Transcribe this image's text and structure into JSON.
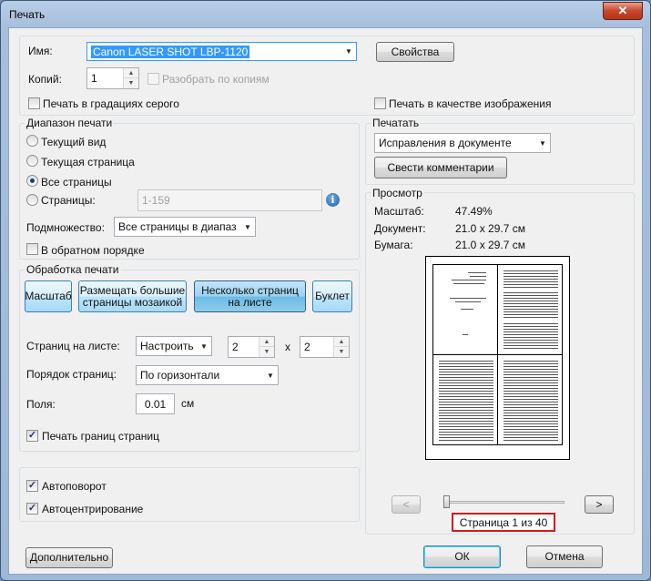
{
  "window": {
    "title": "Печать",
    "close_glyph": "✕"
  },
  "printer": {
    "name_label": "Имя:",
    "name_value": "Canon LASER SHOT LBP-1120",
    "properties_button": "Свойства",
    "copies_label": "Копий:",
    "copies_value": "1",
    "collate_label": "Разобрать по копиям",
    "grayscale_label": "Печать в градациях серого",
    "print_as_image_label": "Печать в качестве изображения"
  },
  "range": {
    "title": "Диапазон печати",
    "options": [
      "Текущий вид",
      "Текущая страница",
      "Все страницы",
      "Страницы:"
    ],
    "selected_index": 2,
    "pages_placeholder": "1-159",
    "subset_label": "Подмножество:",
    "subset_value": "Все страницы в диапаз",
    "reverse_label": "В обратном порядке",
    "info_glyph": "i"
  },
  "handling": {
    "title": "Обработка печати",
    "modes": [
      "Масштаб",
      "Размещать большие страницы мозаикой",
      "Несколько страниц на листе",
      "Буклет"
    ],
    "active_mode_index": 2,
    "pages_per_sheet_label": "Страниц на листе:",
    "pages_per_sheet_value": "Настроить",
    "cols": "2",
    "times": "x",
    "rows": "2",
    "page_order_label": "Порядок страниц:",
    "page_order_value": "По горизонтали",
    "margins_label": "Поля:",
    "margins_value": "0.01",
    "margins_unit": "см",
    "print_borders_label": "Печать границ страниц",
    "print_borders_checked": true
  },
  "orientation": {
    "autorotate_label": "Автоповорот",
    "autorotate_checked": true,
    "autocenter_label": "Автоцентрирование",
    "autocenter_checked": true
  },
  "print_what": {
    "title": "Печатать",
    "value": "Исправления в документе",
    "summarize_button": "Свести комментарии"
  },
  "preview": {
    "title": "Просмотр",
    "scale_label": "Масштаб:",
    "scale_value": "47.49%",
    "document_label": "Документ:",
    "document_value": "21.0 x 29.7 см",
    "paper_label": "Бумага:",
    "paper_value": "21.0 x 29.7 см",
    "prev_glyph": "<",
    "next_glyph": ">",
    "page_indicator": "Страница 1 из 40",
    "slider_position": 0.0
  },
  "footer": {
    "advanced_button": "Дополнительно",
    "ok_button": "ОК",
    "cancel_button": "Отмена"
  },
  "colors": {
    "highlight_border": "#d11b1b",
    "active_button": "#6cbbe6"
  }
}
